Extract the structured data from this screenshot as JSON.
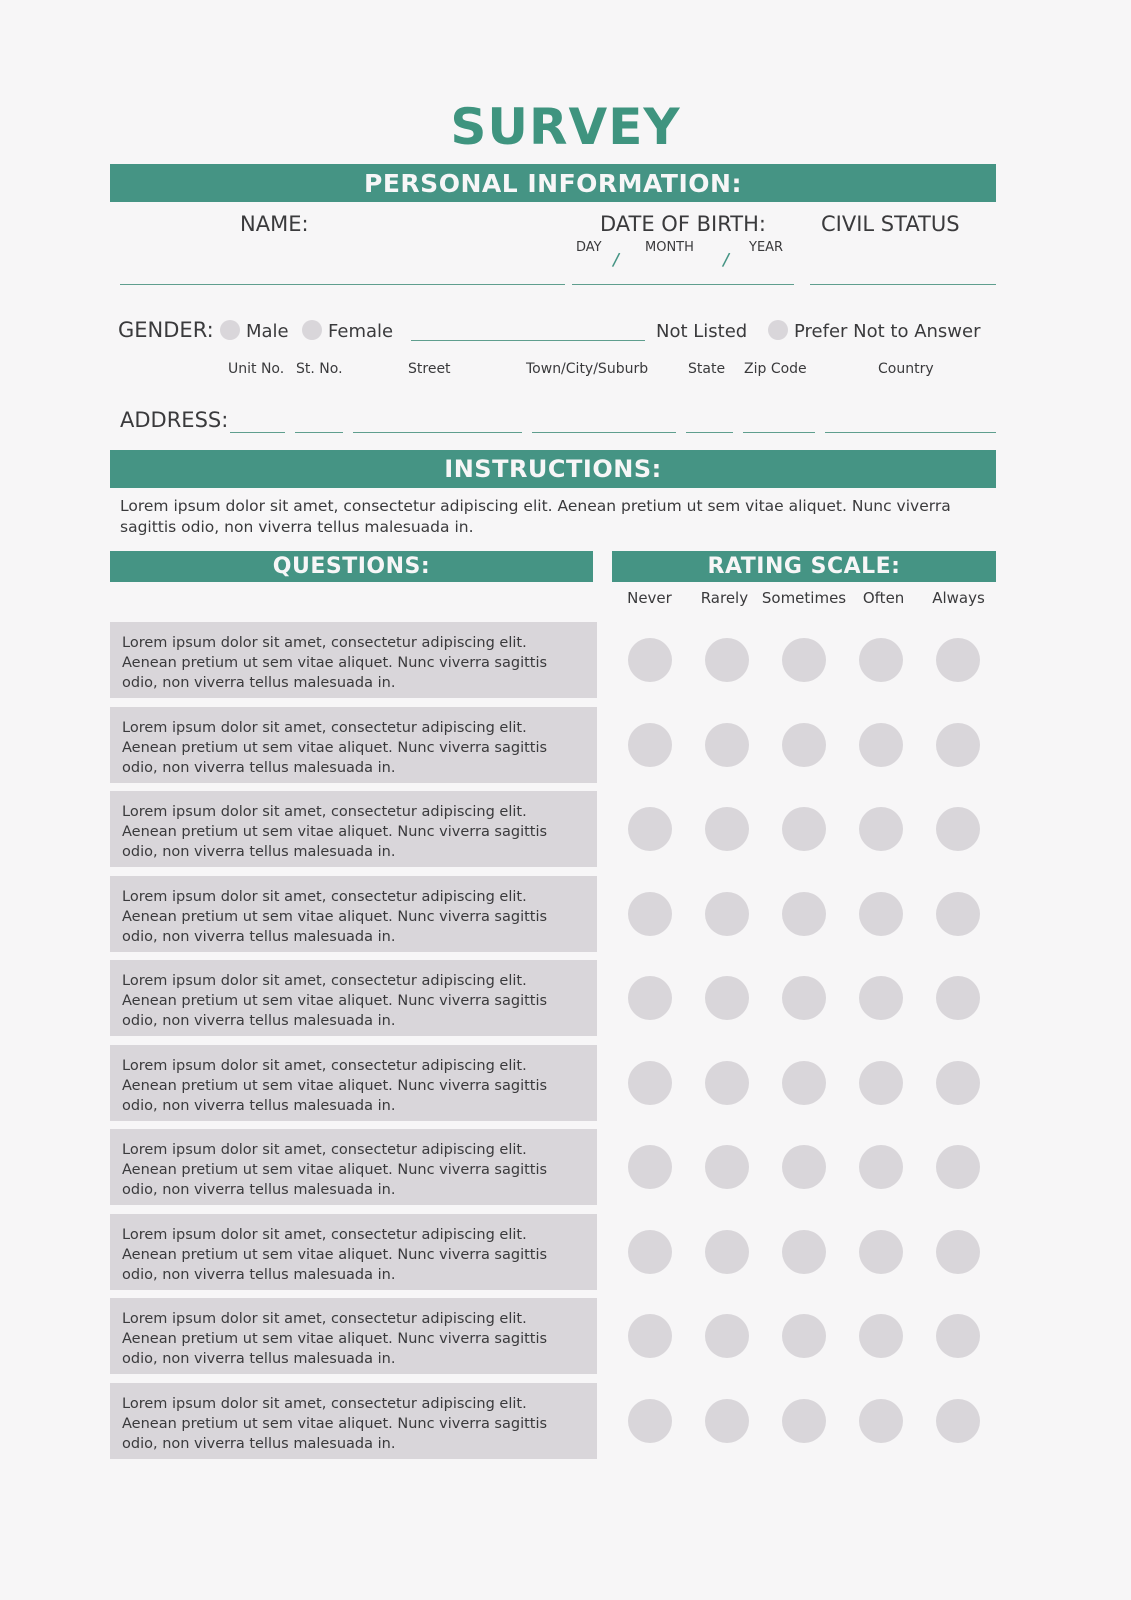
{
  "title": "SURVEY",
  "colors": {
    "accent": "#459484",
    "title": "#3f947f",
    "page_bg": "#f7f6f7",
    "field_bg": "#d9d6da",
    "text": "#3a3a3c",
    "rule": "#5f9e8e"
  },
  "sections": {
    "personal_information": "PERSONAL INFORMATION:",
    "instructions": "INSTRUCTIONS:",
    "questions": "QUESTIONS:",
    "rating_scale": "RATING SCALE:"
  },
  "personal": {
    "name_label": "NAME:",
    "dob_label": "DATE OF BIRTH:",
    "civil_status_label": "CIVIL STATUS",
    "day_label": "DAY",
    "month_label": "MONTH",
    "year_label": "YEAR",
    "slash": "/",
    "name_value": "",
    "dob_value": "",
    "civil_status_value": ""
  },
  "gender": {
    "label": "GENDER:",
    "male": "Male",
    "female": "Female",
    "not_listed": "Not Listed",
    "prefer_not": "Prefer Not to Answer",
    "not_listed_value": ""
  },
  "address": {
    "label": "ADDRESS:",
    "headers": [
      "Unit No.",
      "St. No.",
      "Street",
      "Town/City/Suburb",
      "State",
      "Zip Code",
      "Country"
    ],
    "values": [
      "",
      "",
      "",
      "",
      "",
      "",
      ""
    ]
  },
  "instructions_text": "Lorem ipsum dolor sit amet, consectetur adipiscing elit. Aenean pretium ut sem vitae aliquet. Nunc viverra sagittis odio, non viverra tellus malesuada in.",
  "scale": {
    "options": [
      "Never",
      "Rarely",
      "Sometimes",
      "Often",
      "Always"
    ]
  },
  "questions": [
    {
      "text": "Lorem ipsum dolor sit amet, consectetur adipiscing elit. Aenean pretium ut sem vitae aliquet. Nunc viverra sagittis odio, non viverra tellus malesuada in.",
      "selected": null
    },
    {
      "text": "Lorem ipsum dolor sit amet, consectetur adipiscing elit. Aenean pretium ut sem vitae aliquet. Nunc viverra sagittis odio, non viverra tellus malesuada in.",
      "selected": null
    },
    {
      "text": "Lorem ipsum dolor sit amet, consectetur adipiscing elit. Aenean pretium ut sem vitae aliquet. Nunc viverra sagittis odio, non viverra tellus malesuada in.",
      "selected": null
    },
    {
      "text": "Lorem ipsum dolor sit amet, consectetur adipiscing elit. Aenean pretium ut sem vitae aliquet. Nunc viverra sagittis odio, non viverra tellus malesuada in.",
      "selected": null
    },
    {
      "text": "Lorem ipsum dolor sit amet, consectetur adipiscing elit. Aenean pretium ut sem vitae aliquet. Nunc viverra sagittis odio, non viverra tellus malesuada in.",
      "selected": null
    },
    {
      "text": "Lorem ipsum dolor sit amet, consectetur adipiscing elit. Aenean pretium ut sem vitae aliquet. Nunc viverra sagittis odio, non viverra tellus malesuada in.",
      "selected": null
    },
    {
      "text": "Lorem ipsum dolor sit amet, consectetur adipiscing elit. Aenean pretium ut sem vitae aliquet. Nunc viverra sagittis odio, non viverra tellus malesuada in.",
      "selected": null
    },
    {
      "text": "Lorem ipsum dolor sit amet, consectetur adipiscing elit. Aenean pretium ut sem vitae aliquet. Nunc viverra sagittis odio, non viverra tellus malesuada in.",
      "selected": null
    },
    {
      "text": "Lorem ipsum dolor sit amet, consectetur adipiscing elit. Aenean pretium ut sem vitae aliquet. Nunc viverra sagittis odio, non viverra tellus malesuada in.",
      "selected": null
    },
    {
      "text": "Lorem ipsum dolor sit amet, consectetur adipiscing elit. Aenean pretium ut sem vitae aliquet. Nunc viverra sagittis odio, non viverra tellus malesuada in.",
      "selected": null
    }
  ]
}
